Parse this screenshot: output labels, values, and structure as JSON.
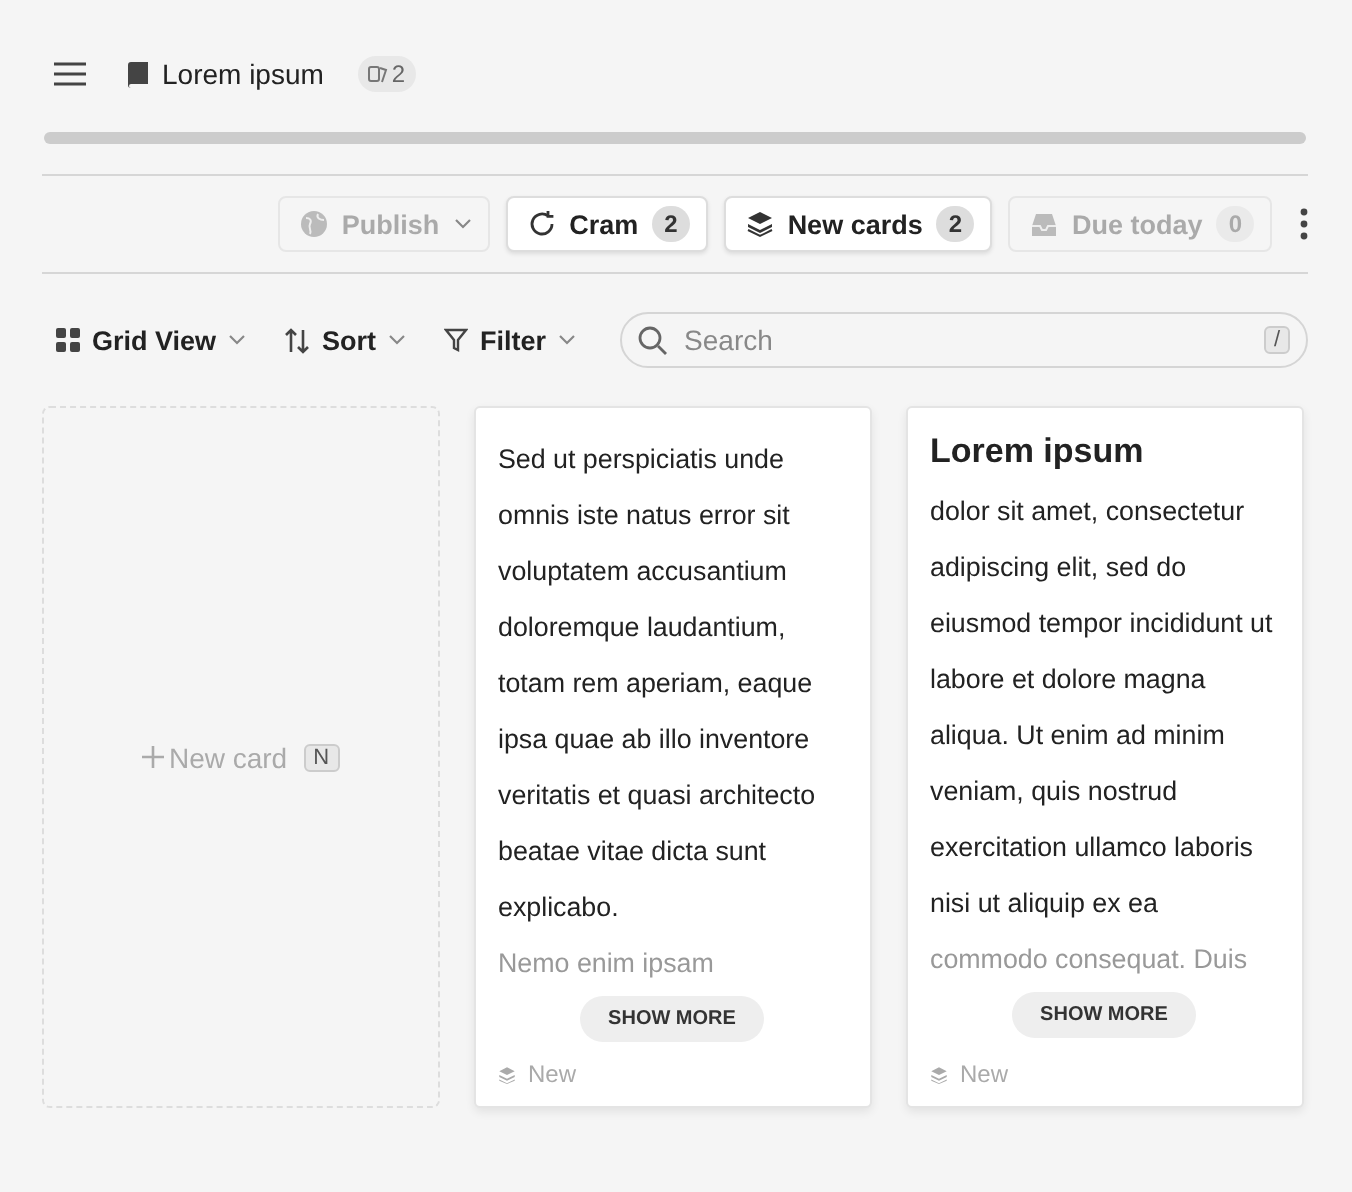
{
  "header": {
    "title": "Lorem ipsum",
    "badge": "2"
  },
  "progress": {
    "level": 0
  },
  "actions": [
    {
      "kind": "publish",
      "label": "Publish",
      "disabled": true,
      "dropdown": true
    },
    {
      "kind": "cram",
      "label": "Cram",
      "count": "2",
      "disabled": false
    },
    {
      "kind": "new",
      "label": "New cards",
      "count": "2",
      "disabled": false
    },
    {
      "kind": "due",
      "label": "Due today",
      "count": "0",
      "disabled": true
    }
  ],
  "view_controls": [
    {
      "kind": "grid",
      "label": "Grid View"
    },
    {
      "kind": "sort",
      "label": "Sort"
    },
    {
      "kind": "filter",
      "label": "Filter"
    }
  ],
  "search": {
    "placeholder": "Search",
    "shortcut": "/"
  },
  "new_card": {
    "label": "New card",
    "shortcut": "N"
  },
  "cards": [
    {
      "body": "Sed ut perspiciatis unde omnis iste natus error sit voluptatem accusantium doloremque laudantium, totam rem aperiam, eaque ipsa quae ab illo inventore veritatis et quasi architecto beatae vitae dicta sunt explicabo.",
      "faded": "Nemo enim ipsam",
      "button": "SHOW MORE",
      "status": "New"
    },
    {
      "title": "Lorem ipsum",
      "body": "dolor sit amet, consectetur adipiscing elit, sed do eiusmod tempor incididunt ut labore et dolore magna aliqua. Ut enim ad minim veniam, quis nostrud exercitation ullamco laboris nisi ut aliquip ex ea",
      "faded": "commodo consequat. Duis",
      "button": "SHOW MORE",
      "status": "New"
    }
  ]
}
